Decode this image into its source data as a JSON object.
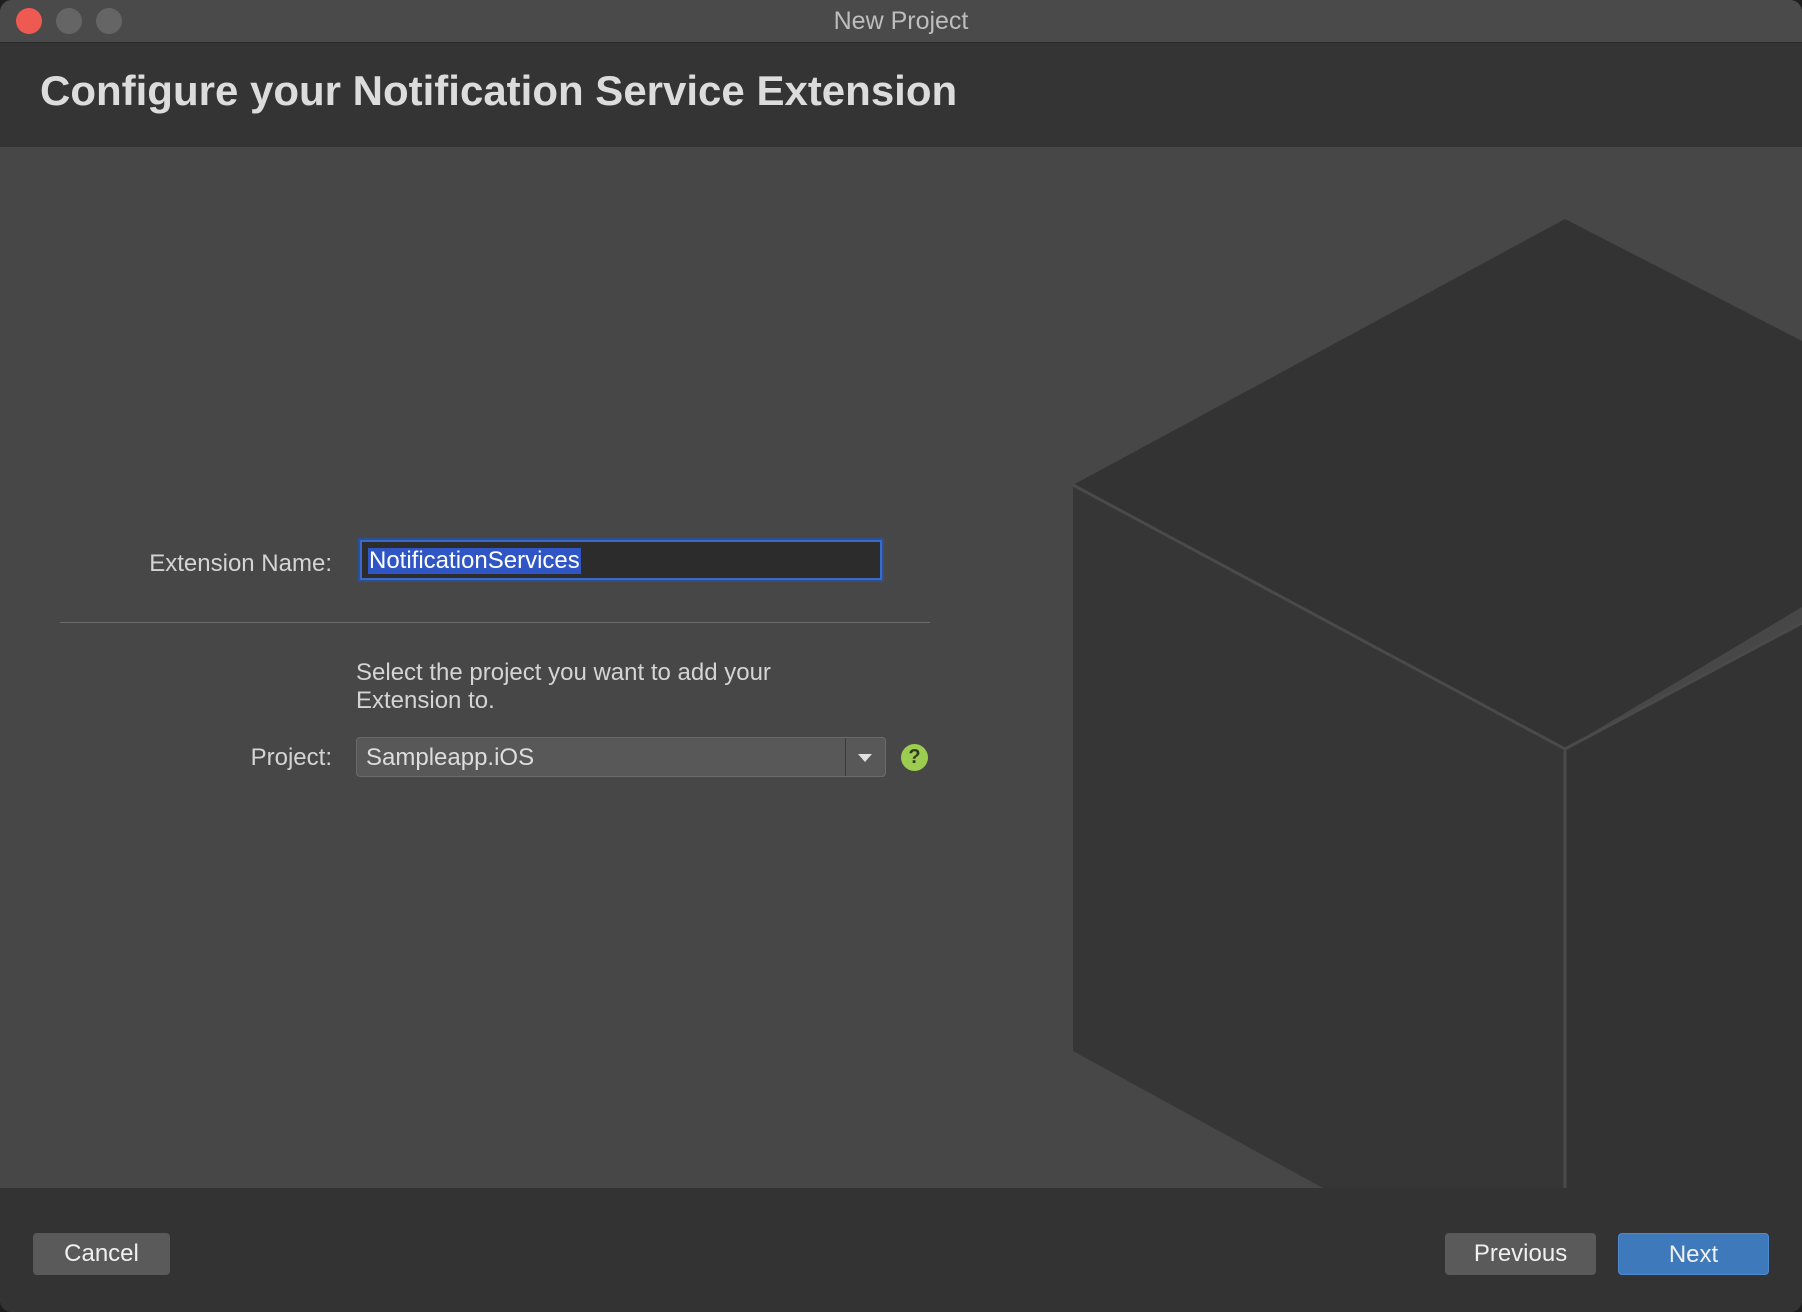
{
  "window": {
    "title": "New Project"
  },
  "header": {
    "title": "Configure your Notification Service Extension"
  },
  "form": {
    "extension_name_label": "Extension Name:",
    "extension_name_value": "NotificationServices",
    "description": "Select the project you want to add your Extension to.",
    "project_label": "Project:",
    "project_value": "Sampleapp.iOS",
    "help_glyph": "?"
  },
  "footer": {
    "cancel_label": "Cancel",
    "previous_label": "Previous",
    "next_label": "Next"
  },
  "colors": {
    "accent": "#3e79bb",
    "selection": "#2f56c4",
    "help": "#9ccc50",
    "close": "#ee5a52"
  },
  "icons": {
    "close": "close-button-icon",
    "minimize": "minimize-button-icon",
    "maximize": "maximize-button-icon",
    "dropdown": "chevron-down-icon",
    "help": "help-icon",
    "background": "cube-icon"
  }
}
